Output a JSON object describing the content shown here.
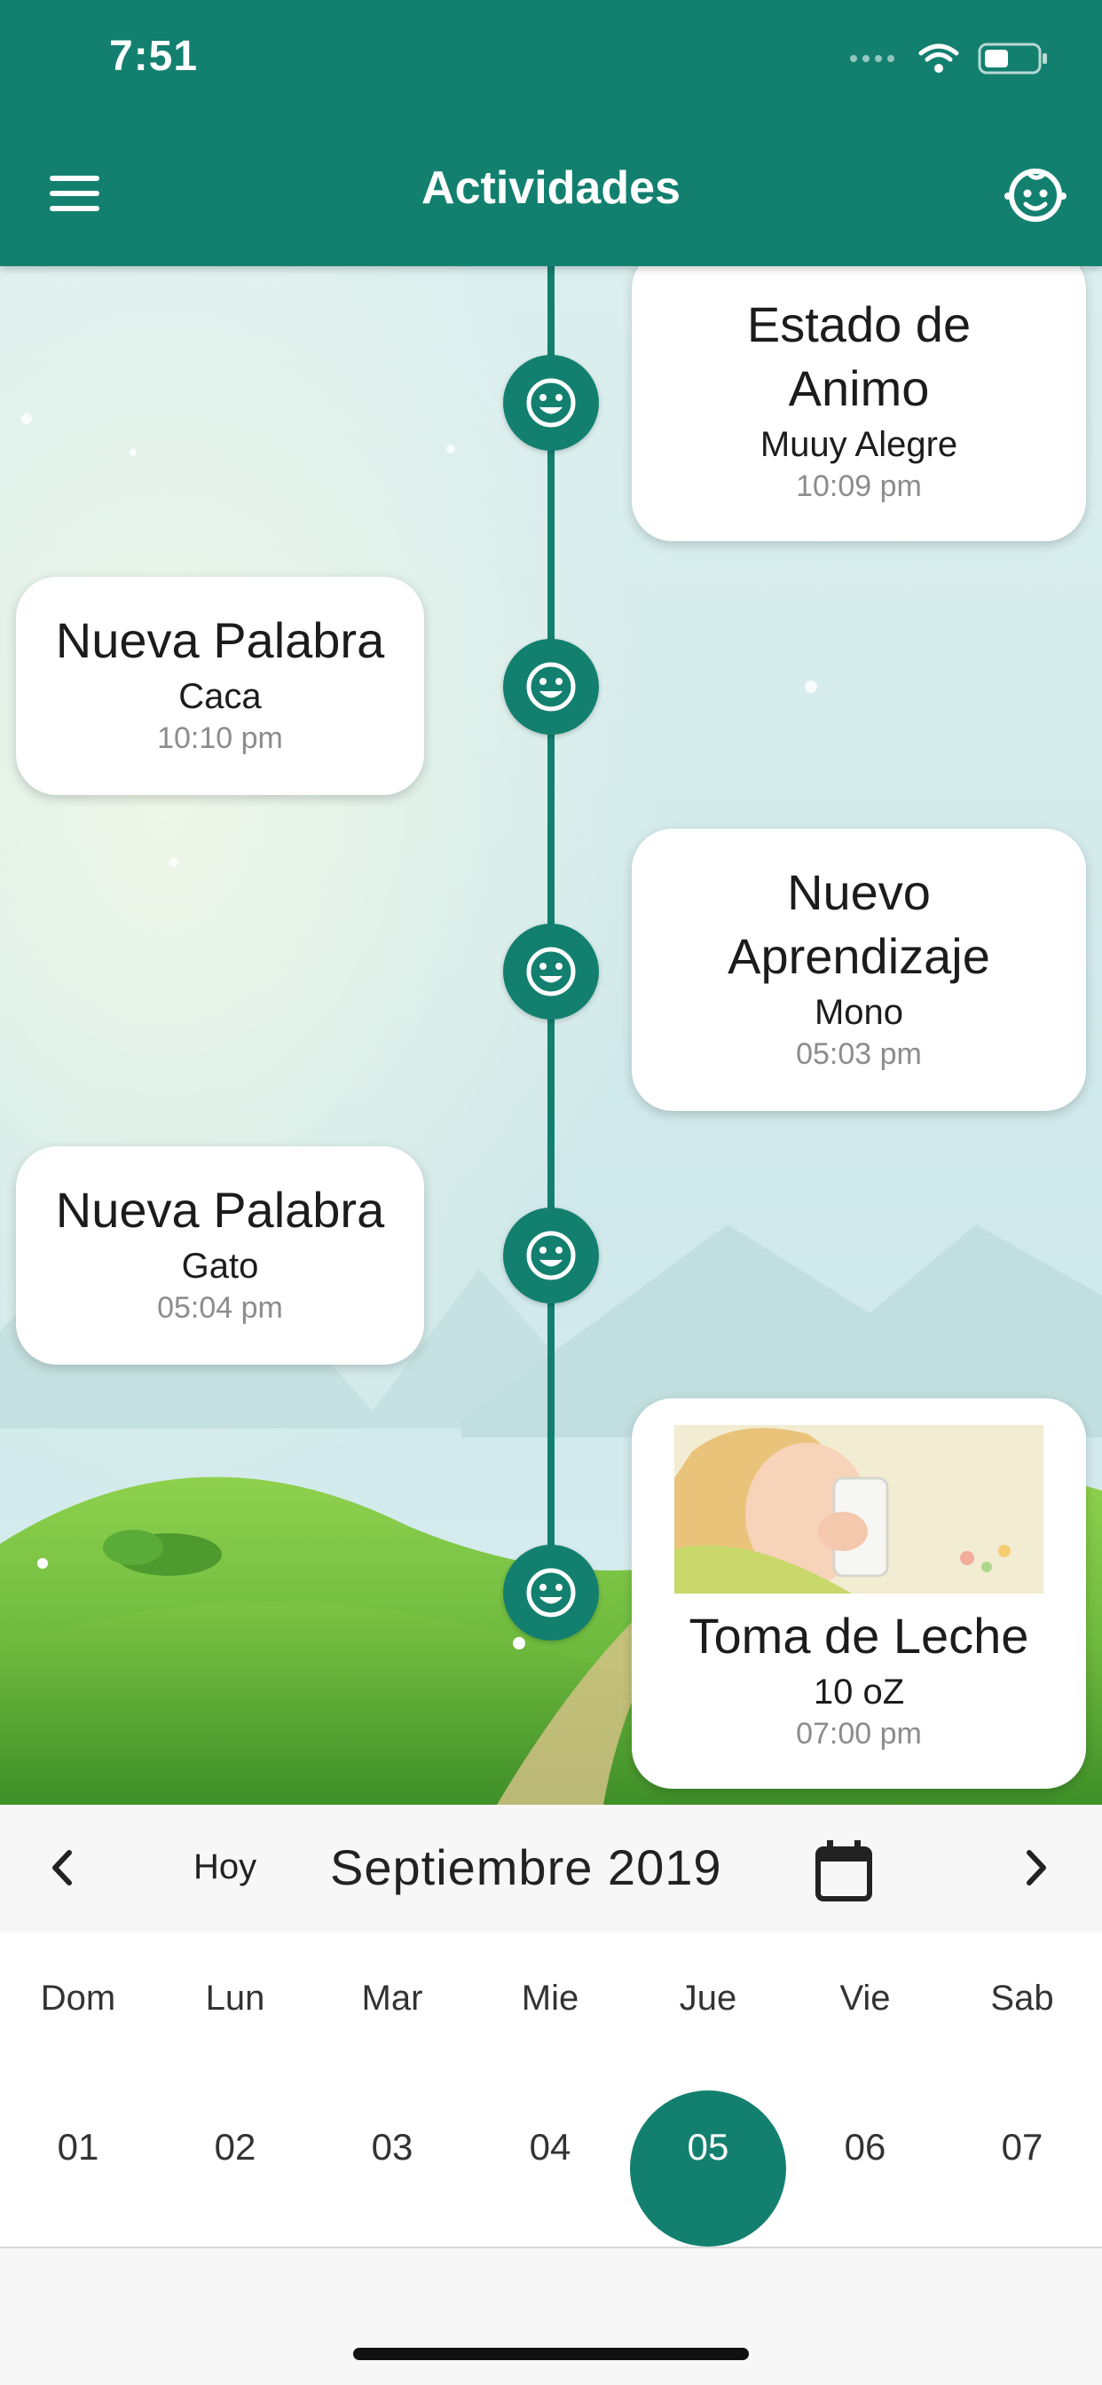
{
  "status": {
    "time": "7:51"
  },
  "header": {
    "title": "Actividades",
    "menu_icon": "menu-icon",
    "profile_icon": "baby-face-icon"
  },
  "theme": {
    "primary": "#13806f"
  },
  "timeline": [
    {
      "title": "Estado de Animo",
      "detail": "Muuy Alegre",
      "time": "10:09 pm",
      "side": "right",
      "icon": "smiley-icon"
    },
    {
      "title": "Nueva Palabra",
      "detail": "Caca",
      "time": "10:10 pm",
      "side": "left",
      "icon": "smiley-icon"
    },
    {
      "title": "Nuevo Aprendizaje",
      "detail": "Mono",
      "time": "05:03 pm",
      "side": "right",
      "icon": "smiley-icon"
    },
    {
      "title": "Nueva Palabra",
      "detail": "Gato",
      "time": "05:04 pm",
      "side": "left",
      "icon": "smiley-icon"
    },
    {
      "title": "Toma de Leche",
      "detail": "10 oZ",
      "time": "07:00 pm",
      "side": "right",
      "icon": "smiley-icon",
      "has_photo": true
    }
  ],
  "calendar": {
    "today_label": "Hoy",
    "month_label": "Septiembre 2019",
    "days": [
      {
        "name": "Dom",
        "num": "01"
      },
      {
        "name": "Lun",
        "num": "02"
      },
      {
        "name": "Mar",
        "num": "03"
      },
      {
        "name": "Mie",
        "num": "04"
      },
      {
        "name": "Jue",
        "num": "05",
        "selected": true
      },
      {
        "name": "Vie",
        "num": "06"
      },
      {
        "name": "Sab",
        "num": "07"
      }
    ]
  }
}
